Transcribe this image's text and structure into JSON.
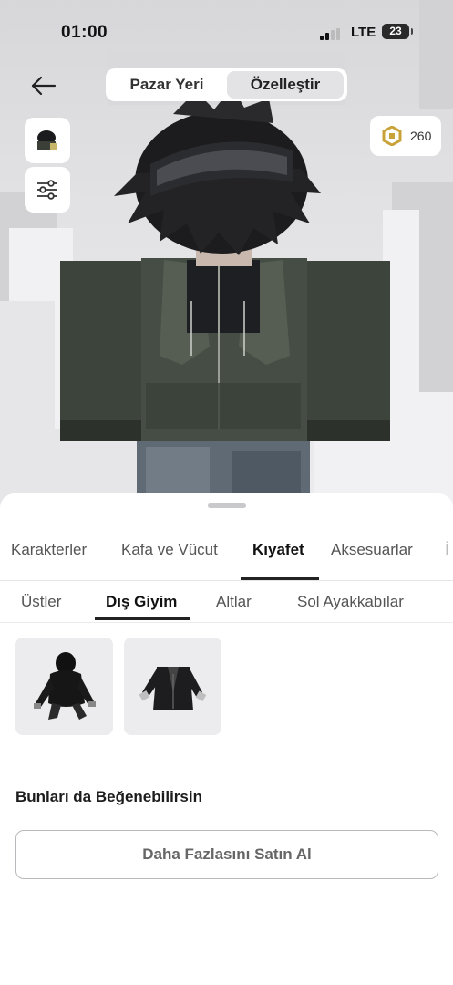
{
  "status_bar": {
    "time": "01:00",
    "network": "LTE",
    "battery": "23"
  },
  "header": {
    "segments": [
      "Pazar Yeri",
      "Özelleştir"
    ],
    "active_segment": "Özelleştir"
  },
  "currency": {
    "amount": "260",
    "icon": "robux-icon"
  },
  "side_buttons": [
    "avatar-thumbnail",
    "filter-sliders-icon"
  ],
  "tabs": {
    "items": [
      "Karakterler",
      "Kafa ve Vücut",
      "Kıyafet",
      "Aksesuarlar",
      "İ"
    ],
    "active": "Kıyafet"
  },
  "subtabs": {
    "items": [
      "Üstler",
      "Dış Giyim",
      "Altlar",
      "Sol Ayakkabılar"
    ],
    "active": "Dış Giyim"
  },
  "items": [
    {
      "name": "black-puffer-hoodie"
    },
    {
      "name": "black-open-jacket"
    }
  ],
  "recommendations": {
    "title": "Bunları da Beğenebilirsin",
    "button_label": "Daha Fazlasını Satın Al"
  },
  "colors": {
    "sheet_bg": "#ffffff",
    "scene_bg": "#e2e2e4",
    "active_text": "#111111",
    "accent_gold": "#c9a33a"
  }
}
